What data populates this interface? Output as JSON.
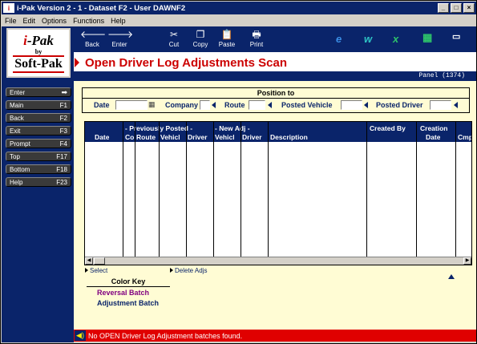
{
  "window": {
    "title": "i-Pak Version 2 - 1 - Dataset F2 - User DAWNF2",
    "app_icon": "i"
  },
  "menu": [
    "File",
    "Edit",
    "Options",
    "Functions",
    "Help"
  ],
  "logo": {
    "brand_i": "i",
    "brand_rest": "-Pak",
    "by": "by",
    "company": "Soft-Pak"
  },
  "toolbar": {
    "back": "Back",
    "enter": "Enter",
    "cut": "Cut",
    "copy": "Copy",
    "paste": "Paste",
    "print": "Print",
    "icons": [
      "ie-icon",
      "word-icon",
      "excel-icon",
      "calculator-icon",
      "card-icon"
    ]
  },
  "nav": [
    {
      "label": "Enter",
      "key": ""
    },
    {
      "label": "Main",
      "key": "F1"
    },
    {
      "label": "Back",
      "key": "F2"
    },
    {
      "label": "Exit",
      "key": "F3"
    },
    {
      "label": "Prompt",
      "key": "F4"
    },
    {
      "label": "Top",
      "key": "F17"
    },
    {
      "label": "Bottom",
      "key": "F18"
    },
    {
      "label": "Help",
      "key": "F23"
    }
  ],
  "page": {
    "title": "Open Driver Log Adjustments Scan",
    "panel": "Panel  (1374)"
  },
  "position": {
    "title": "Position to",
    "date": "Date",
    "company": "Company",
    "route": "Route",
    "posted_vehicle": "Posted Vehicle",
    "posted_driver": "Posted Driver"
  },
  "grid": {
    "group_prev": "- Previously Posted -",
    "group_new": "- New Adj -",
    "cols": {
      "date": "Date",
      "co": "Co",
      "route": "Route",
      "vehicle1": "Vehicl",
      "driver1": "Driver",
      "vehicle2": "Vehicl",
      "driver2": "Driver",
      "description": "Description",
      "created_by": "Created By",
      "creation": "Creation",
      "date2": "Date",
      "cmp": "Cmp"
    }
  },
  "actions": {
    "select": "Select",
    "delete": "Delete Adjs"
  },
  "color_key": {
    "title": "Color Key",
    "reversal": "Reversal Batch",
    "reversal_color": "#800080",
    "adjustment": "Adjustment Batch",
    "adjustment_color": "#0a246a"
  },
  "status": {
    "message": "No OPEN Driver Log Adjustment batches found."
  }
}
